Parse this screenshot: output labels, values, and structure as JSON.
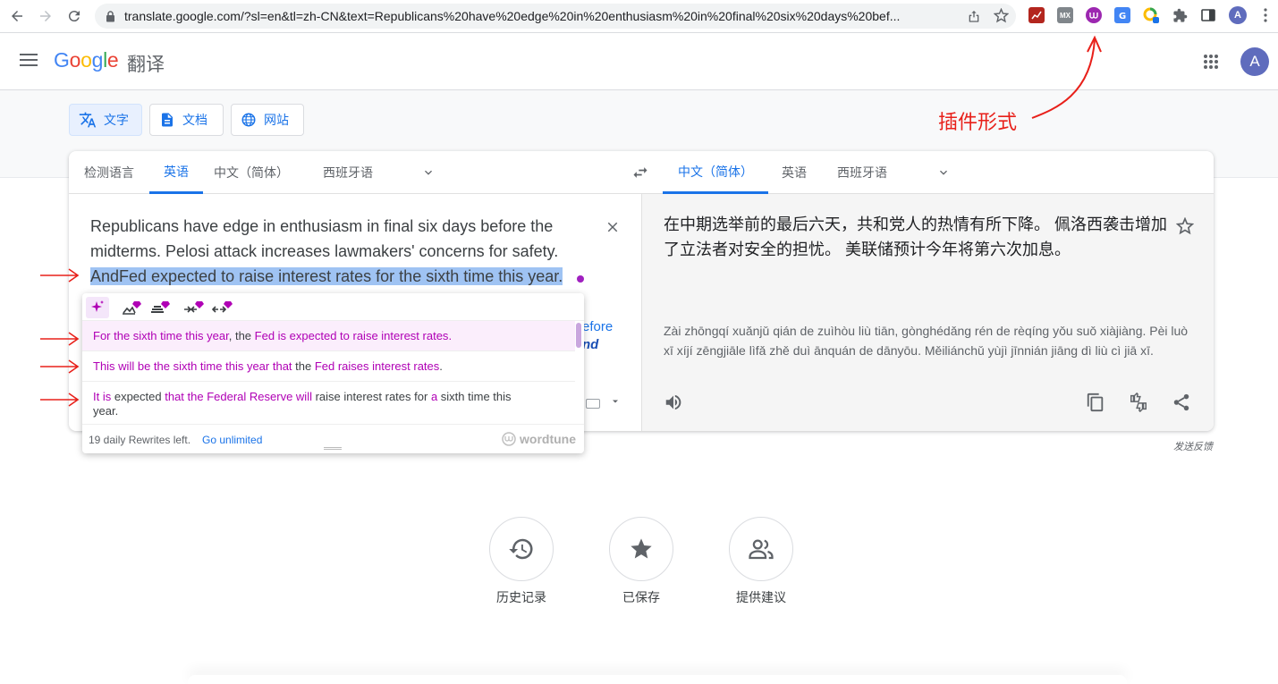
{
  "browser": {
    "url": "translate.google.com/?sl=en&tl=zh-CN&text=Republicans%20have%20edge%20in%20enthusiasm%20in%20final%20six%20days%20bef...",
    "profile_initial": "A",
    "ext_mx_label": "MX"
  },
  "header": {
    "logo": "Google",
    "logo_suffix": "翻译",
    "avatar_initial": "A"
  },
  "modes": [
    {
      "label": "文字"
    },
    {
      "label": "文档"
    },
    {
      "label": "网站"
    }
  ],
  "annotation": {
    "label": "插件形式",
    "color": "#e8201a"
  },
  "source_langs": [
    "检测语言",
    "英语",
    "中文（简体）",
    "西班牙语"
  ],
  "target_langs": [
    "中文（简体）",
    "英语",
    "西班牙语"
  ],
  "source": {
    "text_plain": "Republicans have edge in enthusiasm in final six days before the midterms. Pelosi attack increases lawmakers' concerns for safety. ",
    "text_selected": "AndFed expected to raise interest rates for the sixth time this year.",
    "peek_1": "efore",
    "peek_2": "nd"
  },
  "target": {
    "text": "在中期选举前的最后六天，共和党人的热情有所下降。 佩洛西袭击增加了立法者对安全的担忧。 美联储预计今年将第六次加息。",
    "romanized": "Zài zhōngqí xuǎnjǔ qián de zuìhòu liù tiān, gònghédǎng rén de rèqíng yǒu suǒ xiàjiàng. Pèi luò xī xíjí zēngjiāle lìfǎ zhě duì ānquán de dānyōu. Měiliánchǔ yùjì jīnnián jiāng dì liù cì jiā xī."
  },
  "wordtune": {
    "suggestions": [
      [
        [
          "For the sixth time this year",
          true
        ],
        [
          ", the ",
          false
        ],
        [
          "Fed is expected to raise interest rates",
          true
        ],
        [
          ".",
          true
        ]
      ],
      [
        [
          "This will be the sixth time this year that",
          true
        ],
        [
          " the ",
          false
        ],
        [
          "Fed raises interest rates",
          true
        ],
        [
          ".",
          false
        ]
      ],
      [
        [
          "It is",
          true
        ],
        [
          " expected ",
          false
        ],
        [
          "that the Federal Reserve will",
          true
        ],
        [
          " raise interest rates for ",
          false
        ],
        [
          "a",
          true
        ],
        [
          " sixth time this year.",
          false
        ]
      ]
    ],
    "footer_text": "19 daily Rewrites left.",
    "footer_link": "Go unlimited",
    "brand": "wordtune"
  },
  "feedback": "发送反馈",
  "bottom": [
    {
      "label": "历史记录"
    },
    {
      "label": "已保存"
    },
    {
      "label": "提供建议"
    }
  ],
  "colors": {
    "accent": "#1a73e8",
    "wordtune_purple": "#b000b5",
    "selection": "#9fc3f3"
  }
}
